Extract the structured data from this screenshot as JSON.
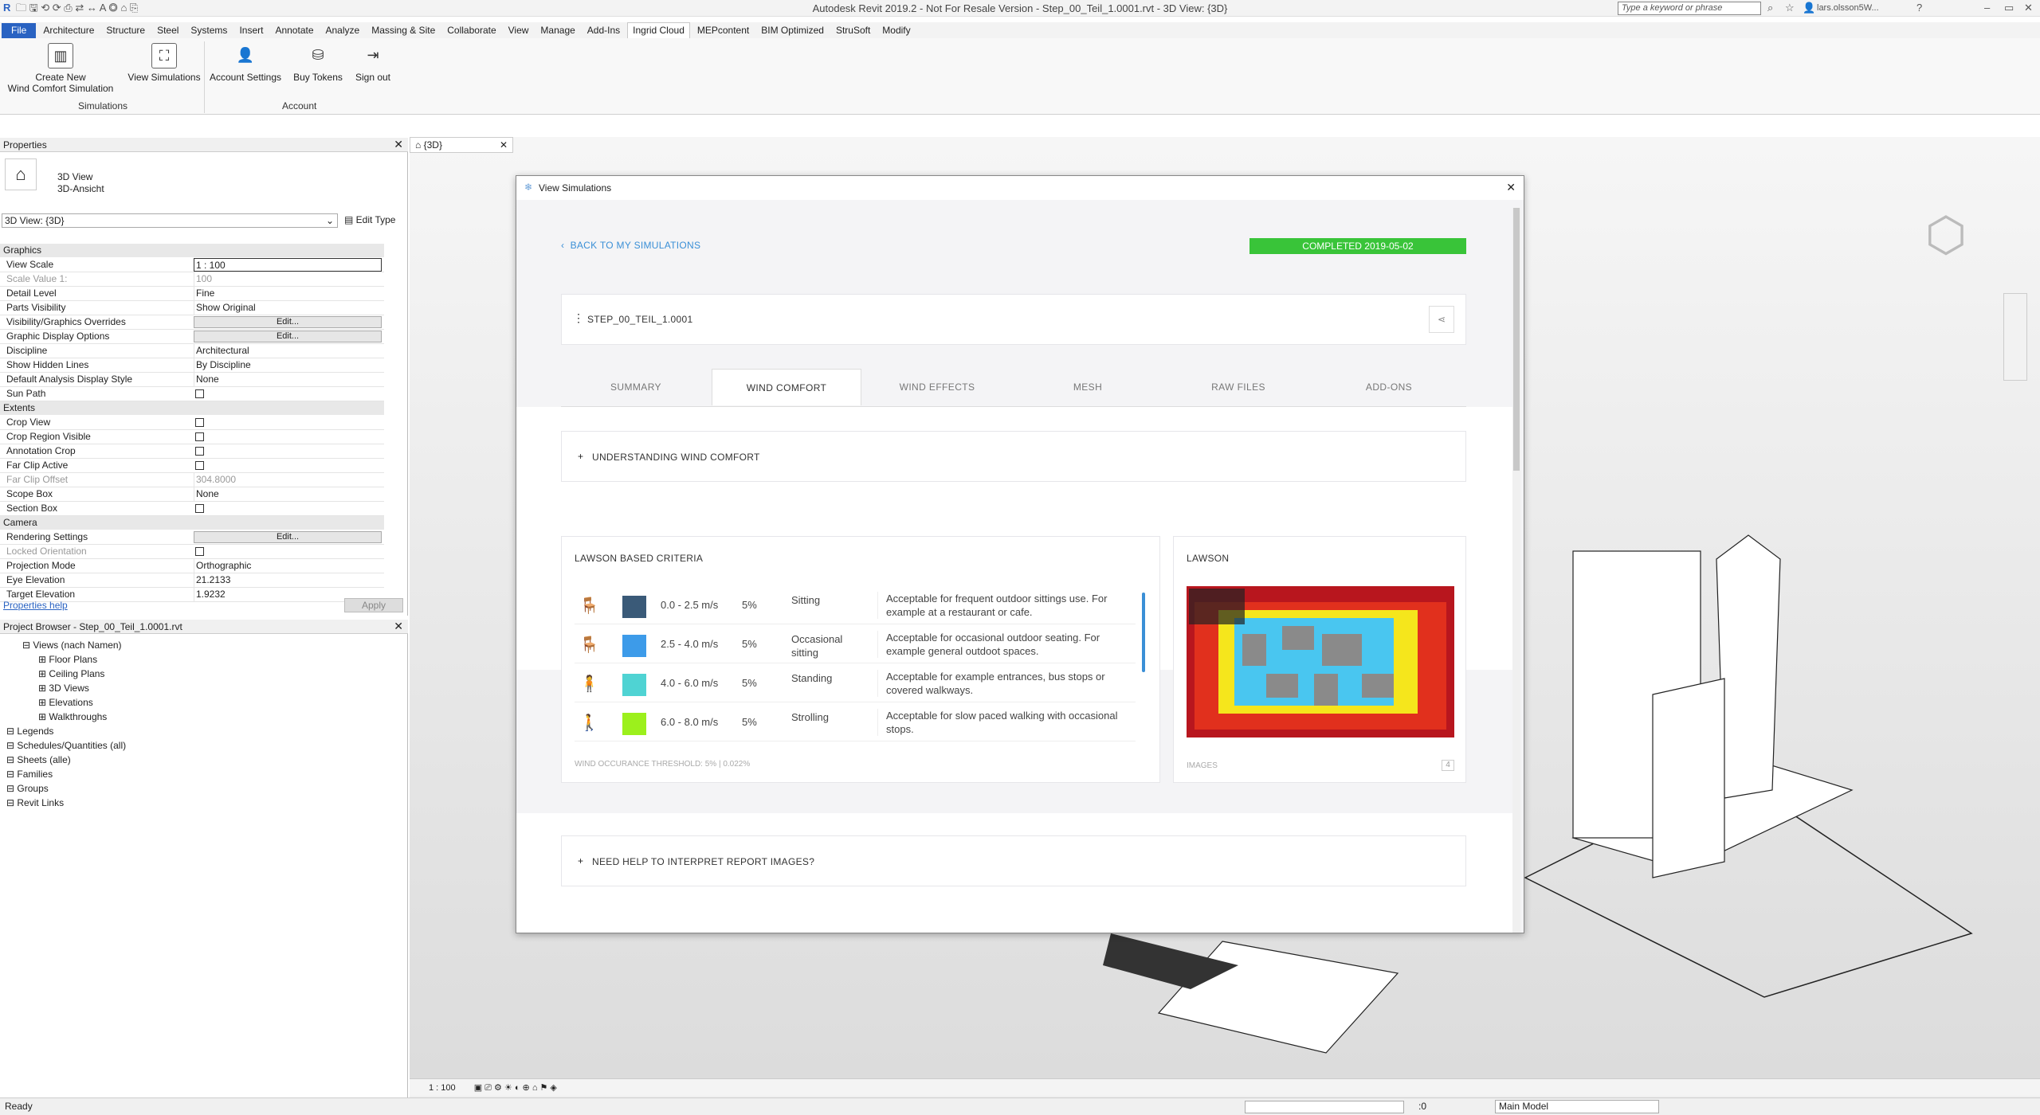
{
  "app": {
    "title": "Autodesk Revit 2019.2 - Not For Resale Version - Step_00_Teil_1.0001.rvt - 3D View: {3D}",
    "search_placeholder": "Type a keyword or phrase",
    "user": "lars.olsson5W..."
  },
  "tabs": [
    "File",
    "Architecture",
    "Structure",
    "Steel",
    "Systems",
    "Insert",
    "Annotate",
    "Analyze",
    "Massing & Site",
    "Collaborate",
    "View",
    "Manage",
    "Add-Ins",
    "Ingrid Cloud",
    "MEPcontent",
    "BIM Optimized",
    "StruSoft",
    "Modify"
  ],
  "ribbon": {
    "create_label": "Create New\nWind Comfort Simulation",
    "view_sims": "View Simulations",
    "account_settings": "Account Settings",
    "buy_tokens": "Buy Tokens",
    "sign_out": "Sign out",
    "panel_simulations": "Simulations",
    "panel_account": "Account"
  },
  "properties": {
    "title": "Properties",
    "type_line1": "3D View",
    "type_line2": "3D-Ansicht",
    "selector": "3D View: {3D}",
    "edit_type": "Edit Type",
    "groups": {
      "graphics": "Graphics",
      "extents": "Extents",
      "camera": "Camera"
    },
    "rows": [
      {
        "k": "View Scale",
        "v": "1 : 100"
      },
      {
        "k": "Scale Value    1:",
        "v": "100"
      },
      {
        "k": "Detail Level",
        "v": "Fine"
      },
      {
        "k": "Parts Visibility",
        "v": "Show Original"
      },
      {
        "k": "Visibility/Graphics Overrides",
        "v": "Edit..."
      },
      {
        "k": "Graphic Display Options",
        "v": "Edit..."
      },
      {
        "k": "Discipline",
        "v": "Architectural"
      },
      {
        "k": "Show Hidden Lines",
        "v": "By Discipline"
      },
      {
        "k": "Default Analysis Display Style",
        "v": "None"
      },
      {
        "k": "Sun Path",
        "v": ""
      },
      {
        "k": "Crop View",
        "v": ""
      },
      {
        "k": "Crop Region Visible",
        "v": ""
      },
      {
        "k": "Annotation Crop",
        "v": ""
      },
      {
        "k": "Far Clip Active",
        "v": ""
      },
      {
        "k": "Far Clip Offset",
        "v": "304.8000"
      },
      {
        "k": "Scope Box",
        "v": "None"
      },
      {
        "k": "Section Box",
        "v": ""
      },
      {
        "k": "Rendering Settings",
        "v": "Edit..."
      },
      {
        "k": "Locked Orientation",
        "v": ""
      },
      {
        "k": "Projection Mode",
        "v": "Orthographic"
      },
      {
        "k": "Eye Elevation",
        "v": "21.2133"
      },
      {
        "k": "Target Elevation",
        "v": "1.9232"
      }
    ],
    "help": "Properties help",
    "apply": "Apply"
  },
  "browser": {
    "title": "Project Browser - Step_00_Teil_1.0001.rvt",
    "items": [
      "Views (nach Namen)",
      "Floor Plans",
      "Ceiling Plans",
      "3D Views",
      "Elevations",
      "Walkthroughs",
      "Legends",
      "Schedules/Quantities (all)",
      "Sheets (alle)",
      "Families",
      "Groups",
      "Revit Links"
    ]
  },
  "view_tab": "{3D}",
  "dialog": {
    "title": "View Simulations",
    "back": "BACK TO MY SIMULATIONS",
    "status": "COMPLETED 2019-05-02",
    "sim_name": "STEP_00_TEIL_1.0001",
    "tabs": [
      "SUMMARY",
      "WIND COMFORT",
      "WIND EFFECTS",
      "MESH",
      "RAW FILES",
      "ADD-ONS"
    ],
    "understanding": "UNDERSTANDING WIND COMFORT",
    "criteria_title": "LAWSON BASED CRITERIA",
    "lawson_title": "LAWSON",
    "criteria": [
      {
        "speed": "0.0 - 2.5 m/s",
        "pct": "5%",
        "activity": "Sitting",
        "desc": "Acceptable for frequent outdoor sittings use. For example at a restaurant or cafe.",
        "color": "#3a5a78"
      },
      {
        "speed": "2.5 - 4.0 m/s",
        "pct": "5%",
        "activity": "Occasional sitting",
        "desc": "Acceptable for occasional outdoor seating. For example general outdoot spaces.",
        "color": "#3d9be9"
      },
      {
        "speed": "4.0 - 6.0 m/s",
        "pct": "5%",
        "activity": "Standing",
        "desc": "Acceptable for example entrances, bus stops or covered walkways.",
        "color": "#4fd3d3"
      },
      {
        "speed": "6.0 - 8.0 m/s",
        "pct": "5%",
        "activity": "Strolling",
        "desc": "Acceptable for slow paced walking with occasional stops.",
        "color": "#9cf01c"
      }
    ],
    "threshold": "WIND OCCURANCE THRESHOLD: 5% | 0.022%",
    "images_label": "IMAGES",
    "images_count": "4",
    "help": "NEED HELP TO INTERPRET REPORT IMAGES?"
  },
  "status": {
    "ready": "Ready",
    "scale": "1 : 100",
    "model": "Main Model",
    "filter": ":0"
  }
}
